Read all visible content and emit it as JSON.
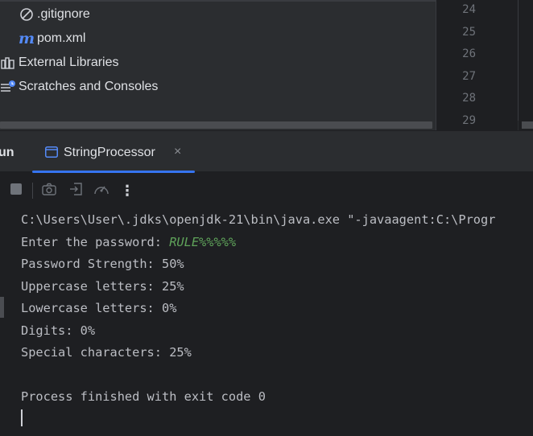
{
  "project_tree": {
    "items": [
      {
        "label": ".gitignore",
        "icon": "ignore-file-icon"
      },
      {
        "label": "pom.xml",
        "icon": "maven-icon",
        "icon_glyph": "m"
      },
      {
        "label": "External Libraries",
        "icon": "library-icon"
      },
      {
        "label": "Scratches and Consoles",
        "icon": "scratches-icon"
      }
    ]
  },
  "editor": {
    "line_numbers": [
      "24",
      "25",
      "26",
      "27",
      "28",
      "29"
    ]
  },
  "tool_window": {
    "title": "un",
    "tab": {
      "label": "StringProcessor",
      "close": "×",
      "icon": "console-tab-icon"
    }
  },
  "toolbar": {
    "buttons": [
      {
        "name": "stop-button",
        "icon": "stop-icon"
      },
      {
        "name": "screenshot-button",
        "icon": "camera-icon"
      },
      {
        "name": "exit-button",
        "icon": "exit-icon"
      },
      {
        "name": "profiler-button",
        "icon": "gauge-icon"
      },
      {
        "name": "more-button",
        "icon": "more-vertical-icon",
        "glyph": "⋮"
      }
    ]
  },
  "console": {
    "command": "C:\\Users\\User\\.jdks\\openjdk-21\\bin\\java.exe \"-javaagent:C:\\Progr",
    "prompt": "Enter the password: ",
    "user_input": "RULE%%%%%",
    "lines": [
      "Password Strength: 50%",
      "Uppercase letters: 25%",
      "Lowercase letters: 0%",
      "Digits: 0%",
      "Special characters: 25%"
    ],
    "exit_message": "Process finished with exit code 0"
  },
  "colors": {
    "background": "#1e1f22",
    "panel": "#2b2d30",
    "accent": "#3574f0",
    "user_input": "#5fa35a",
    "maven": "#548af7"
  }
}
